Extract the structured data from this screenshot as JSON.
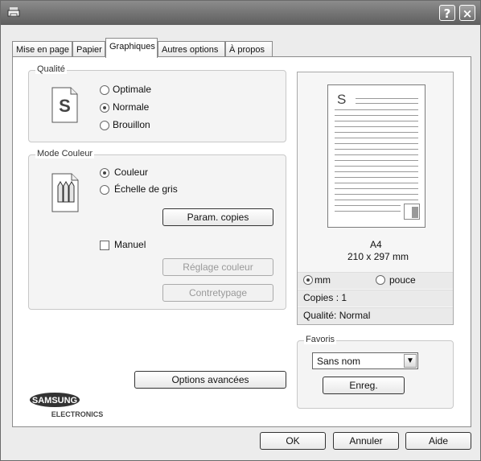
{
  "window": {
    "help_glyph": "?",
    "close_glyph": "×"
  },
  "tabs": [
    {
      "label": "Mise en page"
    },
    {
      "label": "Papier"
    },
    {
      "label": "Graphiques"
    },
    {
      "label": "Autres options"
    },
    {
      "label": "À propos"
    }
  ],
  "quality": {
    "legend": "Qualité",
    "icon_letter": "S",
    "options": [
      "Optimale",
      "Normale",
      "Brouillon"
    ],
    "selected": "Normale"
  },
  "color_mode": {
    "legend": "Mode Couleur",
    "options": [
      "Couleur",
      "Échelle de gris"
    ],
    "selected": "Couleur",
    "param_copies": "Param. copies",
    "manual_label": "Manuel",
    "color_adjust": "Réglage couleur",
    "contretypage": "Contretypage"
  },
  "advanced": {
    "label": "Options avancées"
  },
  "preview": {
    "paper_letter": "S",
    "format": "A4",
    "size": "210 x 297 mm",
    "unit_mm": "mm",
    "unit_inch": "pouce",
    "copies": "Copies : 1",
    "quality": "Qualité: Normal"
  },
  "favorites": {
    "legend": "Favoris",
    "selected": "Sans nom",
    "save_label": "Enreg."
  },
  "brand": {
    "name": "SAMSUNG",
    "division": "ELECTRONICS",
    "color": "#333333"
  },
  "footer": {
    "ok": "OK",
    "cancel": "Annuler",
    "help": "Aide"
  },
  "colors": {
    "accent": "#6b6b6b"
  }
}
